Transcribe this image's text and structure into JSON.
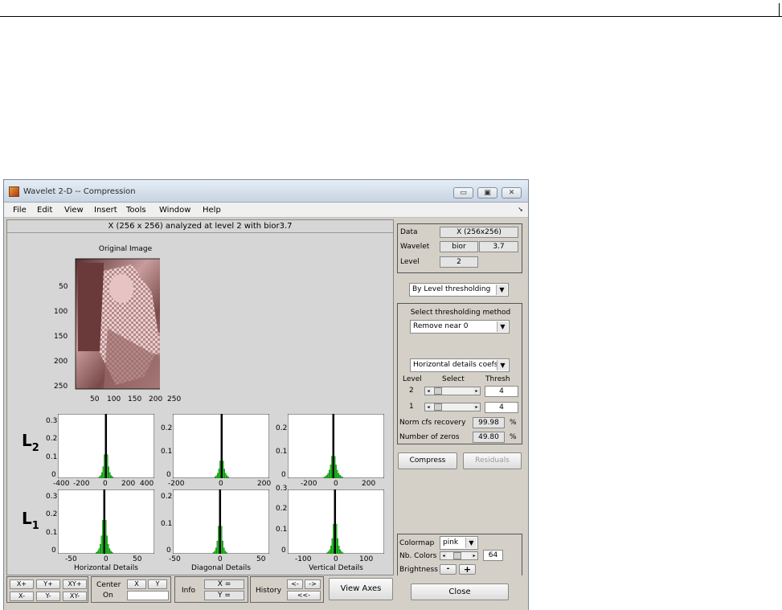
{
  "window": {
    "title": "Wavelet 2-D  --  Compression",
    "controls": {
      "minimize": "▭",
      "maximize": "▣",
      "close": "✕"
    }
  },
  "menu": [
    "File",
    "Edit",
    "View",
    "Insert",
    "Tools",
    "Window",
    "Help"
  ],
  "info_line": "X  (256 x 256)  analyzed at level 2 with bior3.7",
  "original": {
    "title": "Original Image",
    "yticks": [
      "50",
      "100",
      "150",
      "200",
      "250"
    ],
    "xticks": [
      "50",
      "100",
      "150",
      "200",
      "250"
    ]
  },
  "row_labels": {
    "l2": "L",
    "l2_sub": "2",
    "l1": "L",
    "l1_sub": "1"
  },
  "histograms": {
    "l2_h": {
      "yticks": [
        "0.3",
        "0.2",
        "0.1",
        "0"
      ],
      "xticks": [
        "-400",
        "-200",
        "0",
        "200",
        "400"
      ]
    },
    "l2_d": {
      "yticks": [
        "0.2",
        "0.1",
        "0"
      ],
      "xticks": [
        "-200",
        "0",
        "200"
      ]
    },
    "l2_v": {
      "yticks": [
        "0.2",
        "0.1",
        "0"
      ],
      "xticks": [
        "-200",
        "0",
        "200"
      ]
    },
    "l1_h": {
      "yticks": [
        "0.3",
        "0.2",
        "0.1",
        "0"
      ],
      "xticks": [
        "-50",
        "0",
        "50"
      ],
      "xlabel": "Horizontal Details"
    },
    "l1_d": {
      "yticks": [
        "0.2",
        "0.1",
        "0"
      ],
      "xticks": [
        "-50",
        "0",
        "50"
      ],
      "xlabel": "Diagonal Details"
    },
    "l1_v": {
      "yticks": [
        "0.3",
        "0.2",
        "0.1",
        "0"
      ],
      "xticks": [
        "-100",
        "0",
        "100"
      ],
      "xlabel": "Vertical Details"
    }
  },
  "colors": {
    "bars": "#22cc22",
    "bar_edge": "#064006",
    "image_tint": "#c89090"
  },
  "data_box": {
    "data_label": "Data",
    "data_value": "X  (256x256)",
    "wavelet_label": "Wavelet",
    "wavelet_family": "bior",
    "wavelet_number": "3.7",
    "level_label": "Level",
    "level_value": "2"
  },
  "threshold_mode": "By Level thresholding",
  "method_box": {
    "title": "Select thresholding method",
    "method": "Remove near 0",
    "details": "Horizontal details coefs",
    "col_level": "Level",
    "col_select": "Select",
    "col_thresh": "Thresh",
    "rows": [
      {
        "level": "2",
        "thresh": "4"
      },
      {
        "level": "1",
        "thresh": "4"
      }
    ],
    "norm_label": "Norm cfs recovery",
    "norm_value": "99.98",
    "norm_unit": "%",
    "zeros_label": "Number of zeros",
    "zeros_value": "49.80",
    "zeros_unit": "%"
  },
  "buttons": {
    "compress": "Compress",
    "residuals": "Residuals",
    "close": "Close",
    "view_axes": "View Axes"
  },
  "colormap_box": {
    "colormap_label": "Colormap",
    "colormap_value": "pink",
    "nbcolors_label": "Nb. Colors",
    "nbcolors_value": "64",
    "brightness_label": "Brightness",
    "minus": "-",
    "plus": "+"
  },
  "zoom": {
    "xplus": "X+",
    "yplus": "Y+",
    "xyplus": "XY+",
    "xminus": "X-",
    "yminus": "Y-",
    "xyminus": "XY-"
  },
  "center": {
    "label_line1": "Center",
    "label_line2": "On",
    "x": "X",
    "y": "Y"
  },
  "info": {
    "label": "Info",
    "x": "X =",
    "y": "Y ="
  },
  "history": {
    "label": "History",
    "back": "<-",
    "forward": "->",
    "first": "<<-"
  }
}
